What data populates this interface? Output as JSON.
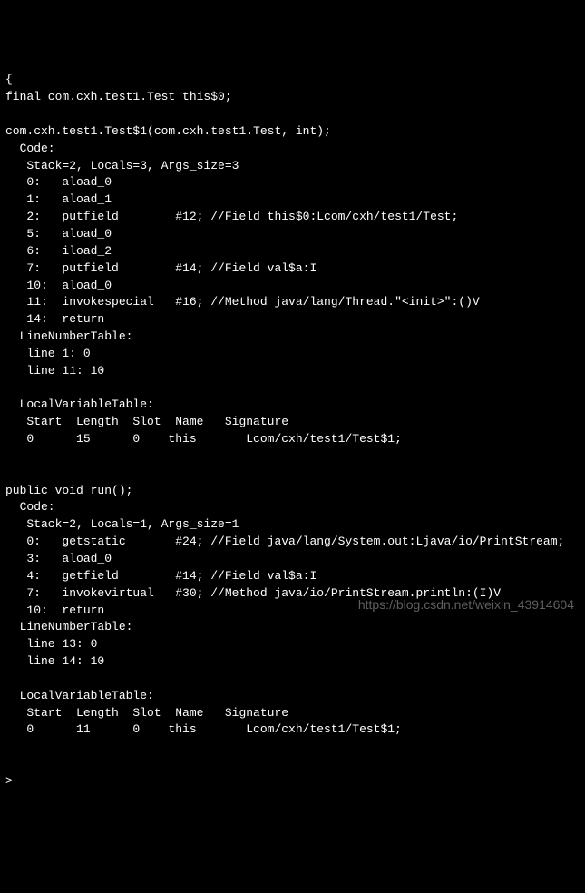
{
  "lines": [
    "{",
    "final com.cxh.test1.Test this$0;",
    "",
    "com.cxh.test1.Test$1(com.cxh.test1.Test, int);",
    "  Code:",
    "   Stack=2, Locals=3, Args_size=3",
    "   0:   aload_0",
    "   1:   aload_1",
    "   2:   putfield        #12; //Field this$0:Lcom/cxh/test1/Test;",
    "   5:   aload_0",
    "   6:   iload_2",
    "   7:   putfield        #14; //Field val$a:I",
    "   10:  aload_0",
    "   11:  invokespecial   #16; //Method java/lang/Thread.\"<init>\":()V",
    "   14:  return",
    "  LineNumberTable:",
    "   line 1: 0",
    "   line 11: 10",
    "",
    "  LocalVariableTable:",
    "   Start  Length  Slot  Name   Signature",
    "   0      15      0    this       Lcom/cxh/test1/Test$1;",
    "",
    "",
    "public void run();",
    "  Code:",
    "   Stack=2, Locals=1, Args_size=1",
    "   0:   getstatic       #24; //Field java/lang/System.out:Ljava/io/PrintStream;",
    "   3:   aload_0",
    "   4:   getfield        #14; //Field val$a:I",
    "   7:   invokevirtual   #30; //Method java/io/PrintStream.println:(I)V",
    "   10:  return",
    "  LineNumberTable:",
    "   line 13: 0",
    "   line 14: 10",
    "",
    "  LocalVariableTable:",
    "   Start  Length  Slot  Name   Signature",
    "   0      11      0    this       Lcom/cxh/test1/Test$1;",
    "",
    "",
    ">"
  ],
  "watermark": "https://blog.csdn.net/weixin_43914604"
}
